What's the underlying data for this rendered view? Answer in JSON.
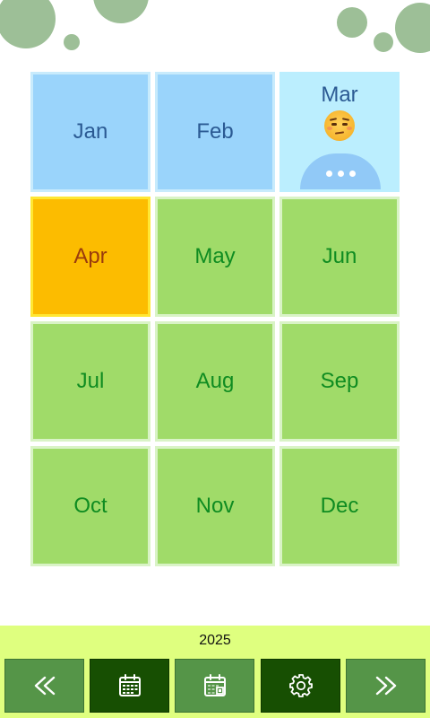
{
  "year": "2025",
  "months": [
    {
      "label": "Jan",
      "state": "past"
    },
    {
      "label": "Feb",
      "state": "past"
    },
    {
      "label": "Mar",
      "state": "current",
      "mood_icon": "unamused-face-icon",
      "more_icon": "more-dots-icon"
    },
    {
      "label": "Apr",
      "state": "selected"
    },
    {
      "label": "May",
      "state": "future"
    },
    {
      "label": "Jun",
      "state": "future"
    },
    {
      "label": "Jul",
      "state": "future"
    },
    {
      "label": "Aug",
      "state": "future"
    },
    {
      "label": "Sep",
      "state": "future"
    },
    {
      "label": "Oct",
      "state": "future"
    },
    {
      "label": "Nov",
      "state": "future"
    },
    {
      "label": "Dec",
      "state": "future"
    }
  ],
  "toolbar": [
    {
      "icon": "double-chevron-left-icon",
      "action": "previous-year"
    },
    {
      "icon": "month-calendar-icon",
      "action": "month-view"
    },
    {
      "icon": "day-calendar-icon",
      "action": "day-view"
    },
    {
      "icon": "gear-icon",
      "action": "settings"
    },
    {
      "icon": "double-chevron-right-icon",
      "action": "next-year"
    }
  ],
  "colors": {
    "past_fill": "#9ad4fb",
    "current_fill": "#bbeefe",
    "selected_fill": "#fcbc00",
    "future_fill": "#a0db69",
    "bottom_bar": "#dfff7f",
    "button_light": "#559548",
    "button_dark": "#174f02",
    "bubbles": "#9dbf97"
  }
}
